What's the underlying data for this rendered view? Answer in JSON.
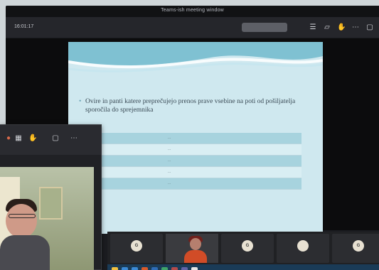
{
  "app": {
    "window_title": "Teams-ish meeting window",
    "timer": "16:01:17"
  },
  "toolbar": {
    "icons": [
      "people-icon",
      "chat-icon",
      "raise-hand-icon",
      "more-icon",
      "expand-icon"
    ]
  },
  "slide": {
    "bullet": "Ovire in panti katere preprečujejo prenos prave vsebine na poti od pošiljatelja sporočila do sprejemnika",
    "rows": [
      {
        "a": "...",
        "b": "..."
      },
      {
        "a": "...",
        "b": "..."
      },
      {
        "a": "...",
        "b": "..."
      },
      {
        "a": "...",
        "b": "..."
      },
      {
        "a": "...",
        "b": "..."
      }
    ]
  },
  "floating_window": {
    "icons": [
      "mic-icon",
      "grid-icon",
      "raise-hand-icon",
      "camera-icon",
      "more-icon"
    ]
  },
  "participants": [
    {
      "avatar": "G",
      "name": ""
    },
    {
      "avatar": "G",
      "name": ""
    },
    {
      "avatar": "",
      "name": ""
    },
    {
      "avatar": "",
      "name": ""
    },
    {
      "avatar": "G",
      "name": ""
    }
  ],
  "colors": {
    "accent": "#2f6e86",
    "slide_bg": "#cfe8ef",
    "taskbar": "#1a3b57"
  }
}
